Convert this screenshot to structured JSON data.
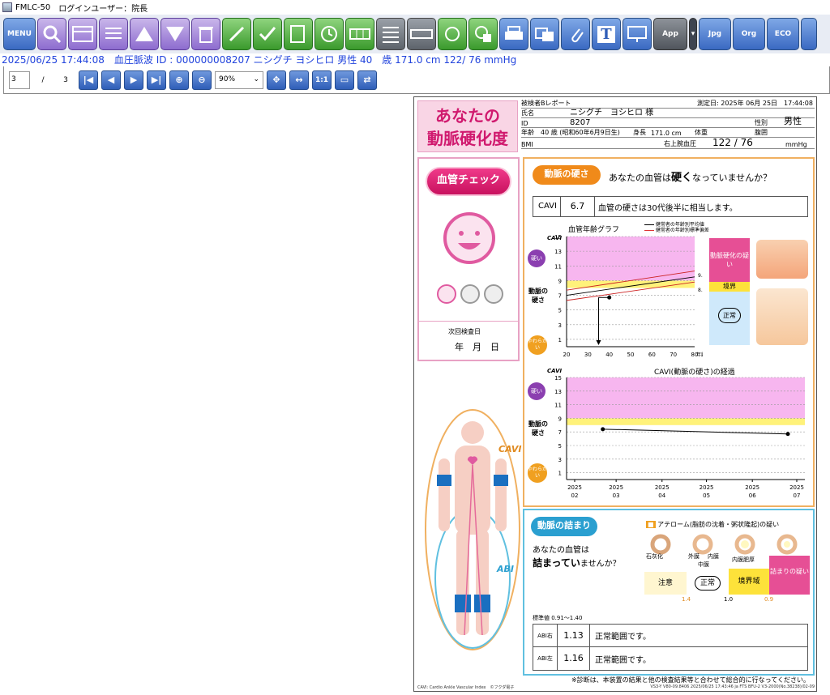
{
  "titlebar": {
    "app": "FMLC-50",
    "login": "ログインユーザー：院長"
  },
  "toolbar": {
    "menu_label": "MENU",
    "app_label": "App",
    "jpg_label": "Jpg",
    "org_label": "Org",
    "eco_label": "ECO",
    "t_label": "T"
  },
  "infobar": {
    "text": "2025/06/25 17:44:08　血圧脈波 ID : 000000008207 ニシグチ ヨシヒロ 男性 40　歳 171.0 cm 122/ 76 mmHg"
  },
  "nav": {
    "page": "3",
    "slash": "/",
    "total": "3",
    "zoom": "90%",
    "fit_label": "1:1"
  },
  "report": {
    "title_line1": "あなたの",
    "title_line2": "動脈硬化度",
    "header": {
      "report_name": "被検者Bレポート",
      "measured": "測定日: 2025年 06月 25日　17:44:08",
      "name_label": "氏名",
      "name": "ニシグチ　ヨシヒロ 様",
      "id_label": "ID",
      "id": "8207",
      "sex_label": "性別",
      "sex": "男性",
      "age_label": "年齢",
      "age": "40 歳 (昭和60年6月9日生)",
      "height_label": "身長",
      "height": "171.0 cm",
      "weight_label": "体重",
      "waist_label": "腹囲",
      "bmi_label": "BMI",
      "bp_label": "右上腕血圧",
      "bp": "122 / 76",
      "bp_unit": "mmHg"
    },
    "vessel_check": "血管チェック",
    "next_exam_label": "次回検査日",
    "next_exam_fields": "年　月　日",
    "cavi_pill": "動脈の硬さ",
    "cavi_question_a": "あなたの血管は",
    "cavi_question_b": "硬く",
    "cavi_question_c": "なっていませんか？",
    "cavi_name": "CAVI",
    "cavi_value": "6.7",
    "cavi_comment": "血管の硬さは30代後半に相当します。",
    "age_graph_title": "血管年齢グラフ",
    "legend1": "健常者の年齢別平均値",
    "legend2": "健常者の年齢別標準偏差",
    "y_axis_label": "CAVI",
    "hard_label": "硬い",
    "soft_label": "やわらかい",
    "stiff_label": "動脈の硬さ",
    "suspect_label": "動脈硬化の疑い",
    "border_label": "境界",
    "normal_label": "正常",
    "x_unit": "年齢",
    "trend_title": "CAVI(動脈の硬さ)の経過",
    "cavi_side_label": "CAVI",
    "abi_side_label": "ABI",
    "abi_pill": "動脈の詰まり",
    "abi_question_a": "あなたの血管は",
    "abi_question_b": "詰まってい",
    "abi_question_c": "ませんか？",
    "athero_label": "アテローム(脂肪の沈着・粥状隆起)の疑い",
    "calc_label": "石灰化",
    "outer_label": "外膜",
    "inner_label": "内膜",
    "media_label": "中膜",
    "thick_label": "内膜肥厚",
    "caution_label": "注意",
    "abi_normal_label": "正常",
    "abi_border_label": "境界域",
    "abi_suspect_label": "詰まりの疑い",
    "abi_t1": "1.4",
    "abi_t2": "1.0",
    "abi_t3": "0.9",
    "std_label": "標準値 0.91〜1.40",
    "abi_rows": [
      {
        "side": "ABI右",
        "value": "1.13",
        "comment": "正常範囲です。"
      },
      {
        "side": "ABI左",
        "value": "1.16",
        "comment": "正常範囲です。"
      }
    ],
    "footnote": "※診断は、本装置の結果と他の検査結果等と合わせて総合的に行なってください。",
    "fine_print": "CAVI: Cardio Ankle Vascular Index　©フクダ電子",
    "fine_print2": "VS3-Y V80-09.8406 2025/06/25 17:43:46 ja FTS BFU-2 V3-2000(No.38238)/02-09"
  },
  "chart_data": [
    {
      "type": "line",
      "title": "血管年齢グラフ",
      "ylabel": "CAVI",
      "xlabel": "年齢",
      "xlim": [
        20,
        80
      ],
      "ylim": [
        0,
        15
      ],
      "x_ticks": [
        20,
        30,
        40,
        50,
        60,
        70,
        80
      ],
      "y_ticks": [
        1,
        3,
        5,
        7,
        9,
        11,
        13,
        15
      ],
      "series": [
        {
          "name": "健常者の年齢別平均値",
          "x": [
            20,
            80
          ],
          "y": [
            7.0,
            9.5
          ]
        },
        {
          "name": "健常者の年齢別標準偏差",
          "x": [
            20,
            80
          ],
          "y": [
            6.3,
            8.8
          ]
        },
        {
          "name": "健常者の年齢別標準偏差",
          "x": [
            20,
            80
          ],
          "y": [
            7.7,
            10.3
          ]
        }
      ],
      "patient_point": {
        "x": 40,
        "y": 6.7
      },
      "arrow_to_x": 35,
      "bands": [
        {
          "from": 8.0,
          "to": 9.0,
          "label": "境界"
        },
        {
          "from": 9.0,
          "to": 15,
          "label": "動脈硬化の疑い"
        }
      ],
      "band_labels": [
        "9.0",
        "8.0"
      ],
      "colors": {
        "suspect": "#f7b6ef",
        "border": "#fff27a",
        "normal": "#cfe9fb"
      }
    },
    {
      "type": "line",
      "title": "CAVI(動脈の硬さ)の経過",
      "ylabel": "CAVI",
      "ylim": [
        0,
        15
      ],
      "y_ticks": [
        1,
        3,
        5,
        7,
        9,
        11,
        13,
        15
      ],
      "x_ticks": [
        "2025 02",
        "2025 03",
        "2025 04",
        "2025 05",
        "2025 06",
        "2025 07"
      ],
      "points": [
        {
          "x": "2025-02-20",
          "y": 7.4
        },
        {
          "x": "2025-06-25",
          "y": 6.7
        }
      ]
    }
  ]
}
